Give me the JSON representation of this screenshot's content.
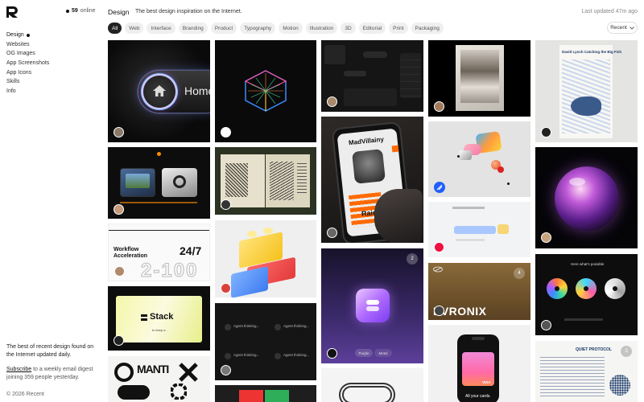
{
  "sidebar": {
    "online_count": "59",
    "online_label": "online",
    "nav": [
      "Design",
      "Websites",
      "OG Images",
      "App Screenshots",
      "App Icons",
      "Skills",
      "Info"
    ],
    "about": "The best of recent design found on the Internet updated daily.",
    "subscribe_link": "Subscribe",
    "digest_text": " to a weekly email digest joining 359 people yesterday.",
    "copyright": "© 2026 Recent"
  },
  "header": {
    "title": "Design",
    "tagline": "The best design inspiration on the Internet.",
    "updated": "Last updated 47m ago"
  },
  "filters": [
    "All",
    "Web",
    "Interface",
    "Branding",
    "Product",
    "Typography",
    "Motion",
    "Illustration",
    "3D",
    "Editorial",
    "Print",
    "Packaging"
  ],
  "sort": {
    "label": "Recent"
  },
  "tiles": {
    "home_label": "Home",
    "workflow_title": "Workflow\nAcceleration",
    "workflow_big": "24/7",
    "workflow_digits": "2-100",
    "stack_label": "Stack",
    "stack_sub": "to keep a",
    "agent_label": "Agent thinking...",
    "phone_title": "MadVillainy",
    "raid_label": "Raid",
    "purple_btns": [
      "Purple",
      "Metal"
    ],
    "purple_count": "2",
    "fish_title": "David Lynch Catching the Big Fish",
    "possible_title": "Here what's possible",
    "evronix": "EVRONIX",
    "evronix_count": "4",
    "quiet_title": "QUIET PROTOCOL",
    "quiet_count": "3",
    "mani_title": "MANTI",
    "phone2_caption": "All your cards.",
    "visa": "VISA"
  }
}
